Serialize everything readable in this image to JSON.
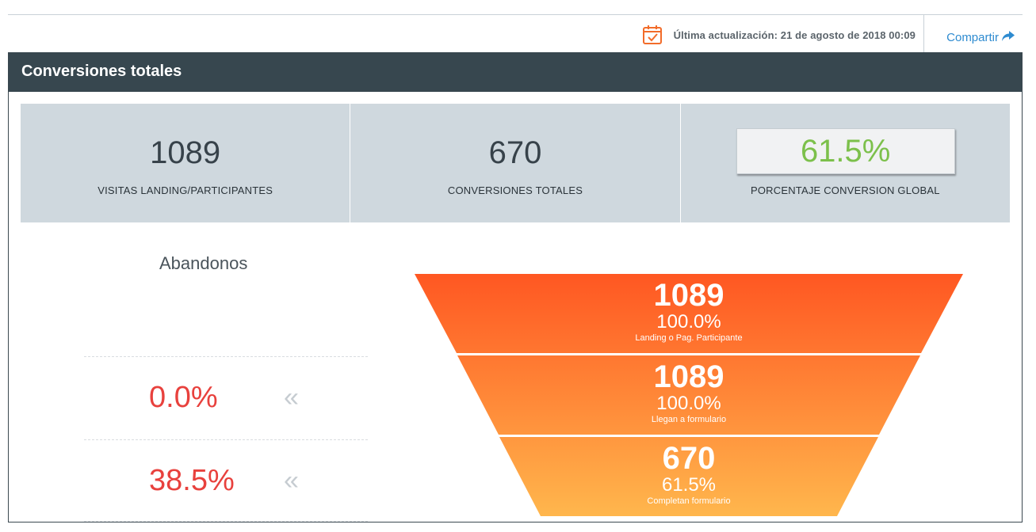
{
  "header": {
    "last_update": "Última actualización: 21 de agosto de 2018 00:09",
    "share_label": "Compartir",
    "calendar_icon": "calendar-check-icon",
    "share_icon": "share-arrow-icon"
  },
  "panel": {
    "title": "Conversiones totales"
  },
  "stats": [
    {
      "value": "1089",
      "label": "VISITAS LANDING/PARTICIPANTES"
    },
    {
      "value": "670",
      "label": "CONVERSIONES TOTALES"
    },
    {
      "value": "61.5%",
      "label": "PORCENTAJE CONVERSION GLOBAL"
    }
  ],
  "abandonos": {
    "title": "Abandonos",
    "rows": [
      {
        "percent": "0.0%",
        "arrow": "«"
      },
      {
        "percent": "38.5%",
        "arrow": "«"
      }
    ]
  },
  "funnel": {
    "stages": [
      {
        "value": "1089",
        "percent": "100.0%",
        "label": "Landing o Pag. Participante"
      },
      {
        "value": "1089",
        "percent": "100.0%",
        "label": "Llegan a formulario"
      },
      {
        "value": "670",
        "percent": "61.5%",
        "label": "Completan formulario"
      }
    ],
    "colors": {
      "top": "#ff5722",
      "bottom": "#ffb74d"
    }
  },
  "colors": {
    "header_bg": "#37474f",
    "stats_bg": "#cfd8de",
    "accent_green": "#7cc04b",
    "abandon_red": "#e8413d",
    "link_blue": "#2e8bd0",
    "calendar_orange": "#f26c2a"
  }
}
